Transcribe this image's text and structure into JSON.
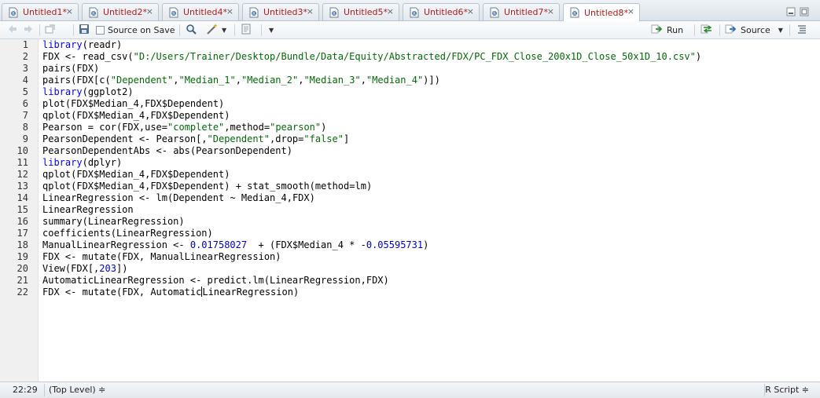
{
  "tabs": [
    {
      "label": "Untitled1*",
      "active": false
    },
    {
      "label": "Untitled2*",
      "active": false
    },
    {
      "label": "Untitled4*",
      "active": false
    },
    {
      "label": "Untitled3*",
      "active": false
    },
    {
      "label": "Untitled5*",
      "active": false
    },
    {
      "label": "Untitled6*",
      "active": false
    },
    {
      "label": "Untitled7*",
      "active": false
    },
    {
      "label": "Untitled8*",
      "active": true
    }
  ],
  "toolbar": {
    "source_on_save_label": "Source on Save",
    "run_label": "Run",
    "source_label": "Source"
  },
  "editor": {
    "line_numbers": [
      "1",
      "2",
      "3",
      "4",
      "5",
      "6",
      "7",
      "8",
      "9",
      "10",
      "11",
      "12",
      "13",
      "14",
      "15",
      "16",
      "17",
      "18",
      "19",
      "20",
      "21",
      "22"
    ],
    "lines": [
      "library(readr)",
      "FDX <- read_csv(\"D:/Users/Trainer/Desktop/Bundle/Data/Equity/Abstracted/FDX/PC_FDX_Close_200x1D_Close_50x1D_10.csv\")",
      "pairs(FDX)",
      "pairs(FDX[c(\"Dependent\",\"Median_1\",\"Median_2\",\"Median_3\",\"Median_4\")])",
      "library(ggplot2)",
      "plot(FDX$Median_4,FDX$Dependent)",
      "qplot(FDX$Median_4,FDX$Dependent)",
      "Pearson = cor(FDX,use=\"complete\",method=\"pearson\")",
      "PearsonDependent <- Pearson[,\"Dependent\",drop=\"false\"]",
      "PearsonDependentAbs <- abs(PearsonDependent)",
      "library(dplyr)",
      "qplot(FDX$Median_4,FDX$Dependent)",
      "qplot(FDX$Median_4,FDX$Dependent) + stat_smooth(method=lm)",
      "LinearRegression <- lm(Dependent ~ Median_4,FDX)",
      "LinearRegression",
      "summary(LinearRegression)",
      "coefficients(LinearRegression)",
      "ManualLinearRegression <- 0.01758027  + (FDX$Median_4 * -0.05595731)",
      "FDX <- mutate(FDX, ManualLinearRegression)",
      "View(FDX[,203])",
      "AutomaticLinearRegression <- predict.lm(LinearRegression,FDX)",
      "FDX <- mutate(FDX, AutomaticLinearRegression)"
    ]
  },
  "status": {
    "cursor_position": "22:29",
    "scope": "(Top Level) ≑",
    "file_type": "R Script ≑"
  },
  "colors": {
    "tab_label": "#b31b1b",
    "keyword": "#0000ff",
    "string": "#036a07",
    "number": "#0000cd"
  }
}
